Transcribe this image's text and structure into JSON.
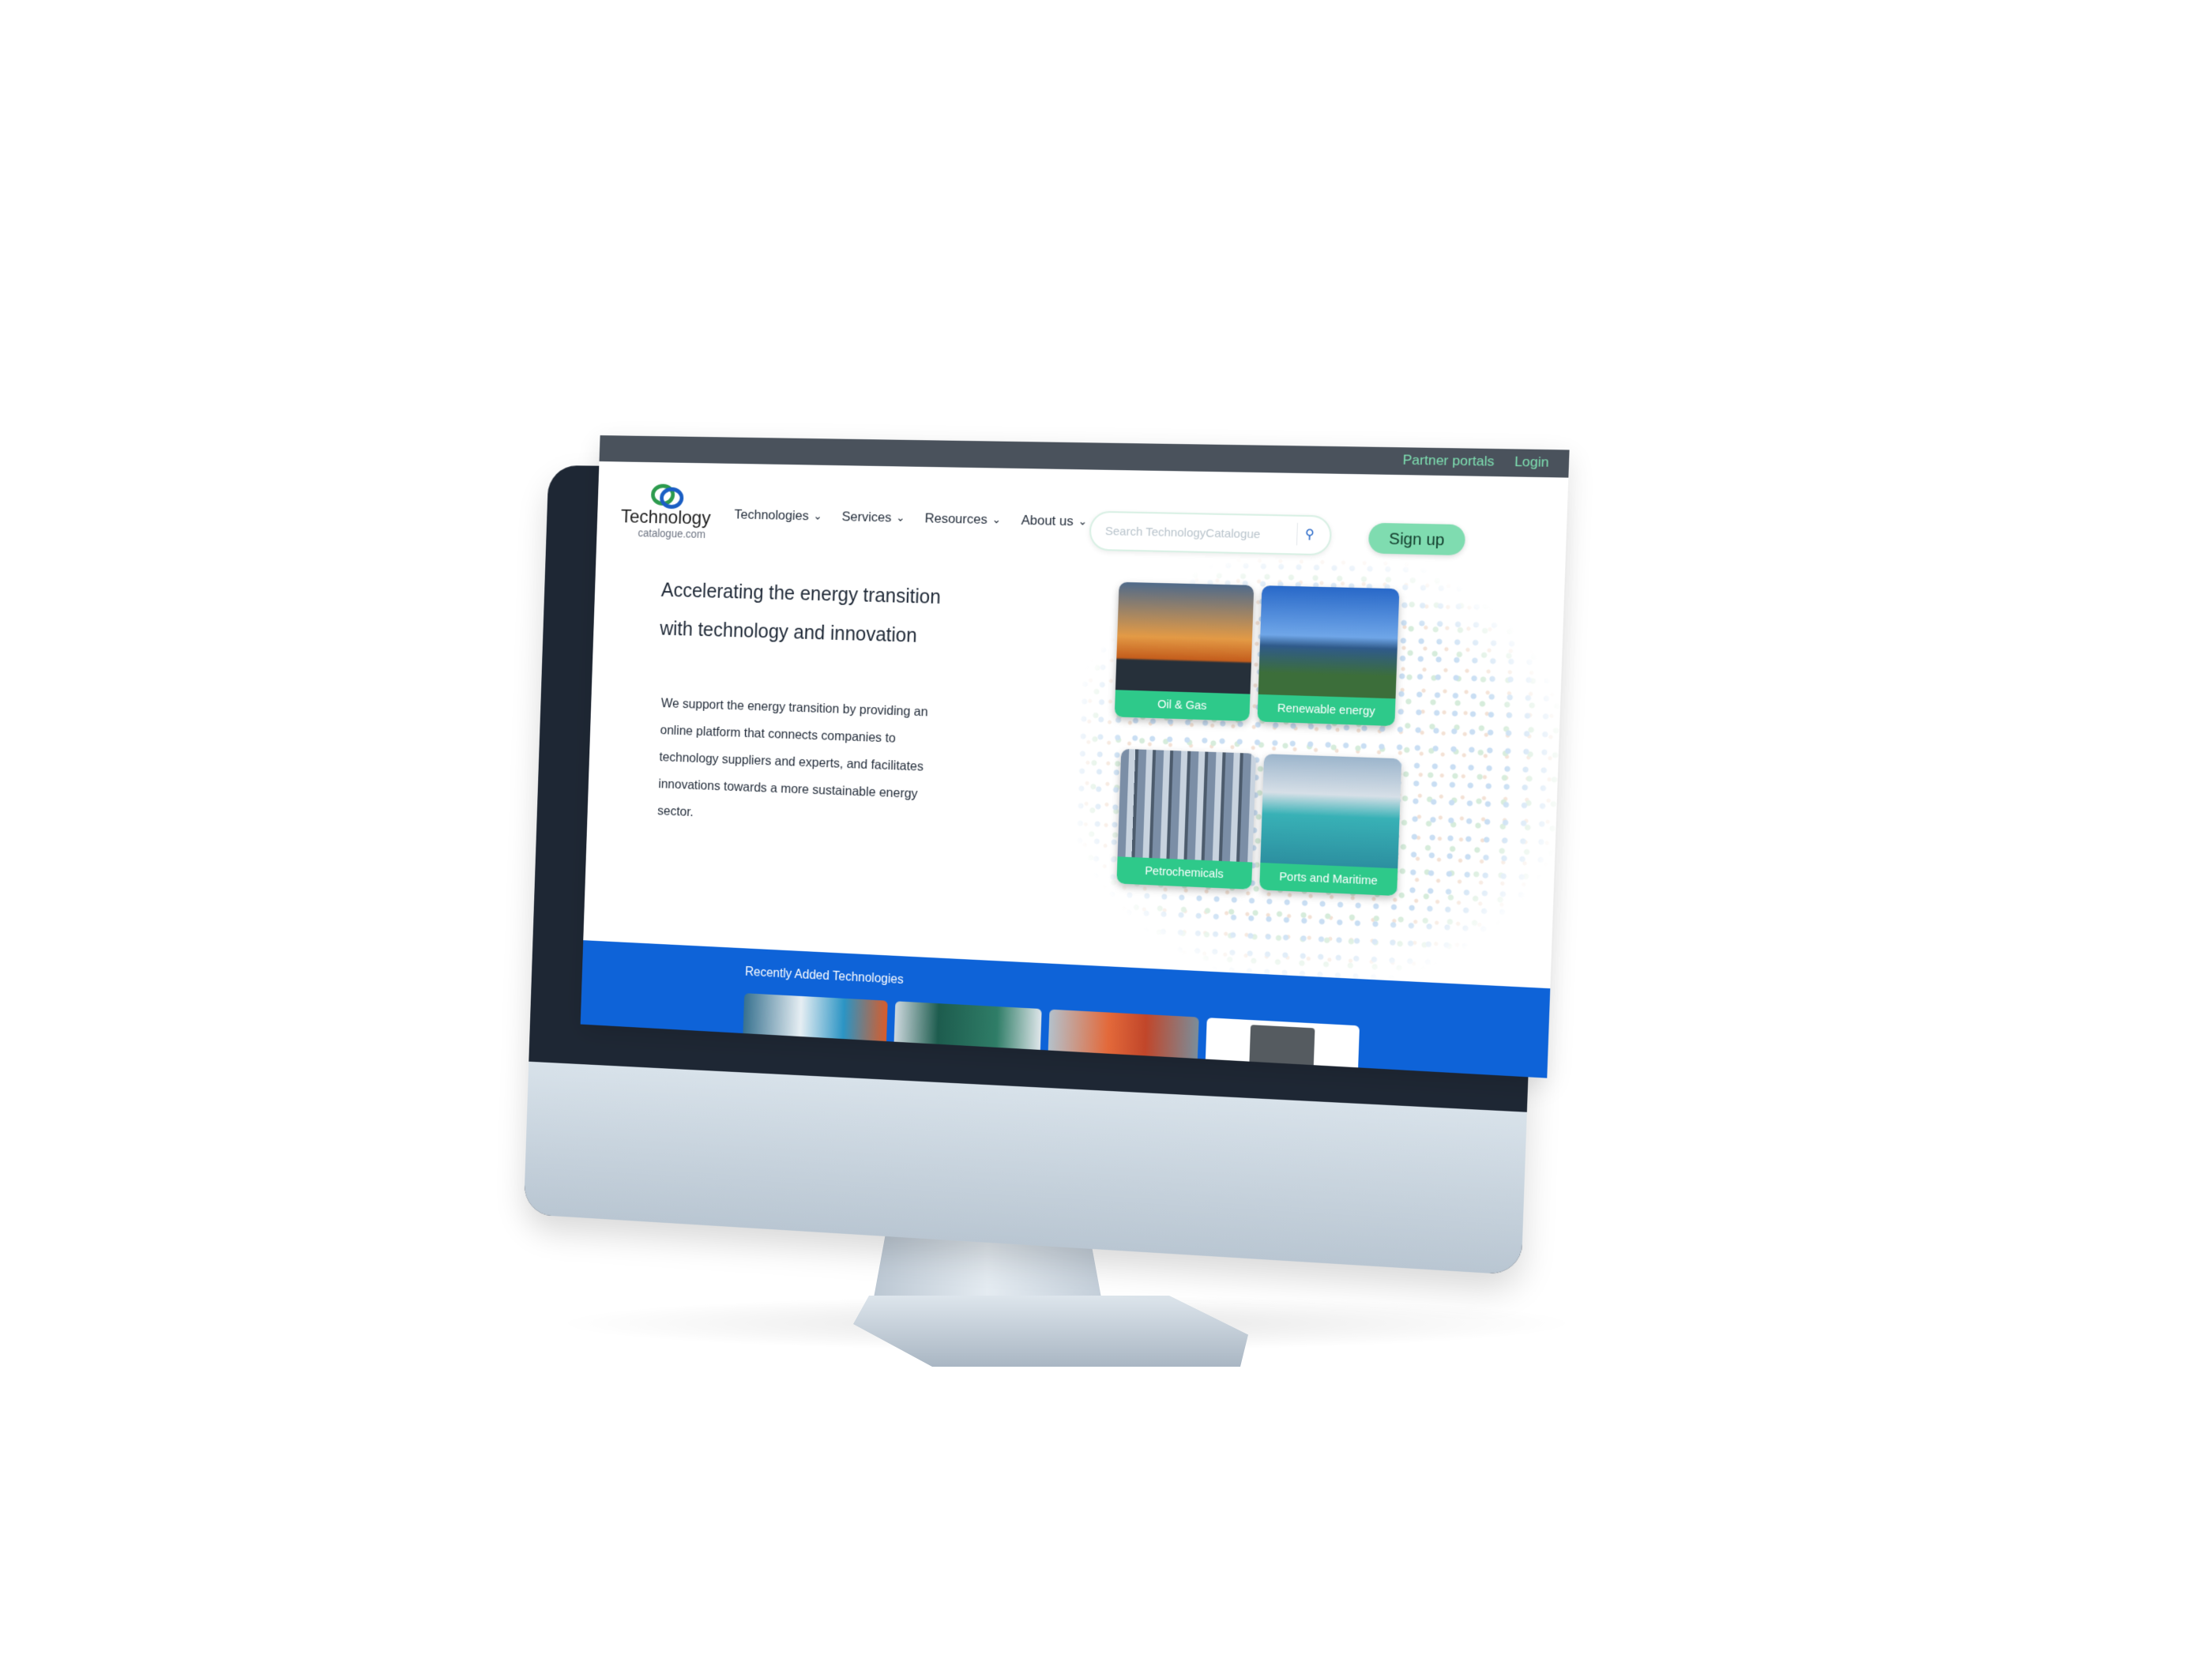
{
  "topbar": {
    "partner_portals": "Partner portals",
    "login": "Login"
  },
  "logo": {
    "word": "Technology",
    "sub": "catalogue.com"
  },
  "nav": [
    {
      "label": "Technologies",
      "icon": "chevron-down-icon"
    },
    {
      "label": "Services",
      "icon": "chevron-down-icon"
    },
    {
      "label": "Resources",
      "icon": "chevron-down-icon"
    },
    {
      "label": "About us",
      "icon": "chevron-down-icon"
    }
  ],
  "search": {
    "placeholder": "Search TechnologyCatalogue",
    "icon": "search-icon"
  },
  "signup": {
    "label": "Sign up"
  },
  "hero": {
    "title_line1": "Accelerating the energy transition",
    "title_line2": "with technology and innovation",
    "text": "We support the energy transition by providing an online platform that connects companies to technology suppliers and experts, and facilitates innovations towards a more sustainable energy sector."
  },
  "categories": [
    {
      "label": "Oil & Gas"
    },
    {
      "label": "Renewable energy"
    },
    {
      "label": "Petrochemicals"
    },
    {
      "label": "Ports and Maritime"
    }
  ],
  "recent": {
    "title": "Recently Added Technologies"
  },
  "colors": {
    "accent_green": "#2ec98a",
    "brand_blue": "#0e63d8",
    "topbar": "#4a525c"
  }
}
